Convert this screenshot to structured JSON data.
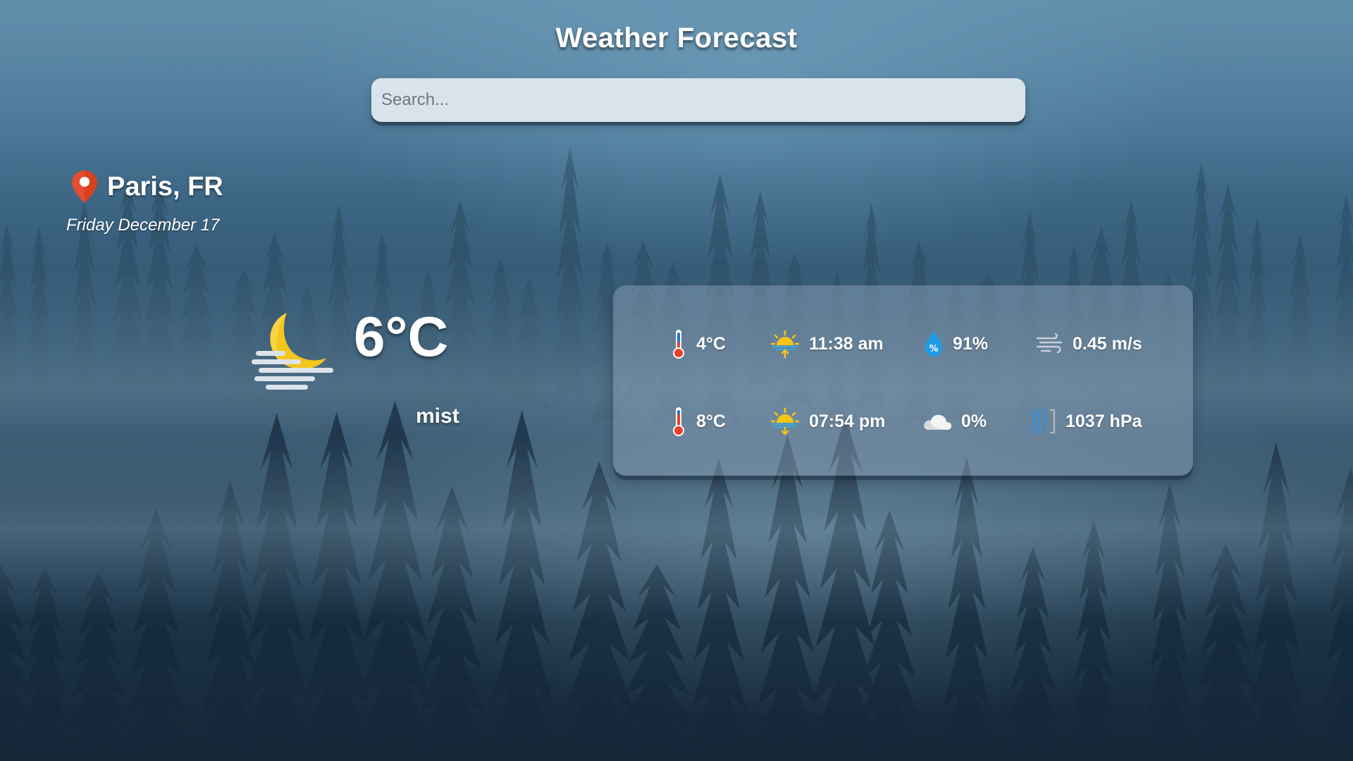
{
  "app": {
    "title": "Weather Forecast"
  },
  "search": {
    "placeholder": "Search...",
    "value": ""
  },
  "location": {
    "city": "Paris, FR",
    "date": "Friday December 17",
    "icon": "map-pin-icon"
  },
  "current": {
    "temperature": "6°C",
    "description": "mist",
    "icon": "moon-mist-icon"
  },
  "details": {
    "temp_min": {
      "value": "4°C",
      "icon": "thermometer-low-icon"
    },
    "sunrise": {
      "value": "11:38 am",
      "icon": "sunrise-icon"
    },
    "humidity": {
      "value": "91%",
      "icon": "humidity-drop-icon"
    },
    "wind": {
      "value": "0.45 m/s",
      "icon": "wind-icon"
    },
    "temp_max": {
      "value": "8°C",
      "icon": "thermometer-high-icon"
    },
    "sunset": {
      "value": "07:54 pm",
      "icon": "sunset-icon"
    },
    "clouds": {
      "value": "0%",
      "icon": "cloud-icon"
    },
    "pressure": {
      "value": "1037 hPa",
      "icon": "pressure-icon"
    }
  },
  "colors": {
    "pin": "#d9411e",
    "sun": "#f5c518",
    "thermometer_low": "#e8412c",
    "thermometer_high": "#e8412c",
    "drop": "#1e9be8",
    "search_bg": "#d8e3ec"
  }
}
